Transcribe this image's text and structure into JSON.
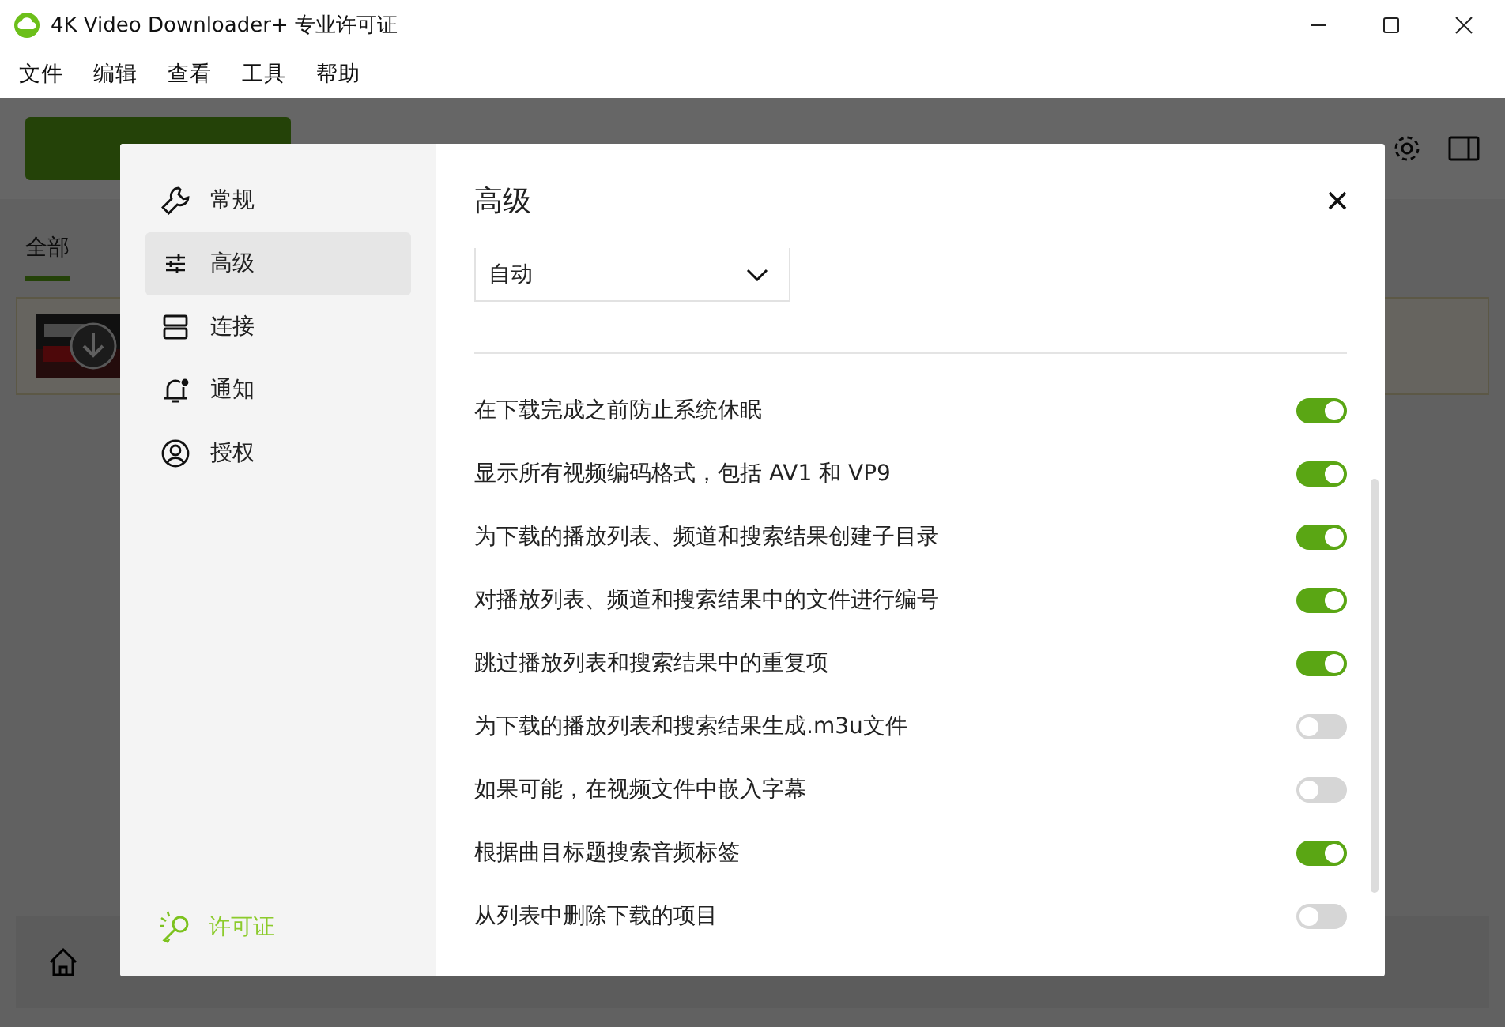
{
  "window": {
    "title": "4K Video Downloader+ 专业许可证"
  },
  "menu": [
    "文件",
    "编辑",
    "查看",
    "工具",
    "帮助"
  ],
  "background": {
    "tabs": [
      {
        "label": "全部",
        "selected": true
      }
    ]
  },
  "dialog": {
    "title": "高级",
    "nav": [
      {
        "label": "常规",
        "kind": "wrench",
        "selected": false
      },
      {
        "label": "高级",
        "kind": "sliders",
        "selected": true
      },
      {
        "label": "连接",
        "kind": "server",
        "selected": false
      },
      {
        "label": "通知",
        "kind": "bell",
        "selected": false
      },
      {
        "label": "授权",
        "kind": "user",
        "selected": false
      }
    ],
    "license_link": "许可证",
    "dropdown": {
      "value": "自动"
    },
    "settings": [
      {
        "label": "在下载完成之前防止系统休眠",
        "on": true
      },
      {
        "label": "显示所有视频编码格式，包括 AV1 和 VP9",
        "on": true
      },
      {
        "label": "为下载的播放列表、频道和搜索结果创建子目录",
        "on": true
      },
      {
        "label": "对播放列表、频道和搜索结果中的文件进行编号",
        "on": true
      },
      {
        "label": "跳过播放列表和搜索结果中的重复项",
        "on": true
      },
      {
        "label": "为下载的播放列表和搜索结果生成.m3u文件",
        "on": false
      },
      {
        "label": "如果可能，在视频文件中嵌入字幕",
        "on": false
      },
      {
        "label": "根据曲目标题搜索音频标签",
        "on": true
      },
      {
        "label": "从列表中删除下载的项目",
        "on": false
      }
    ]
  }
}
